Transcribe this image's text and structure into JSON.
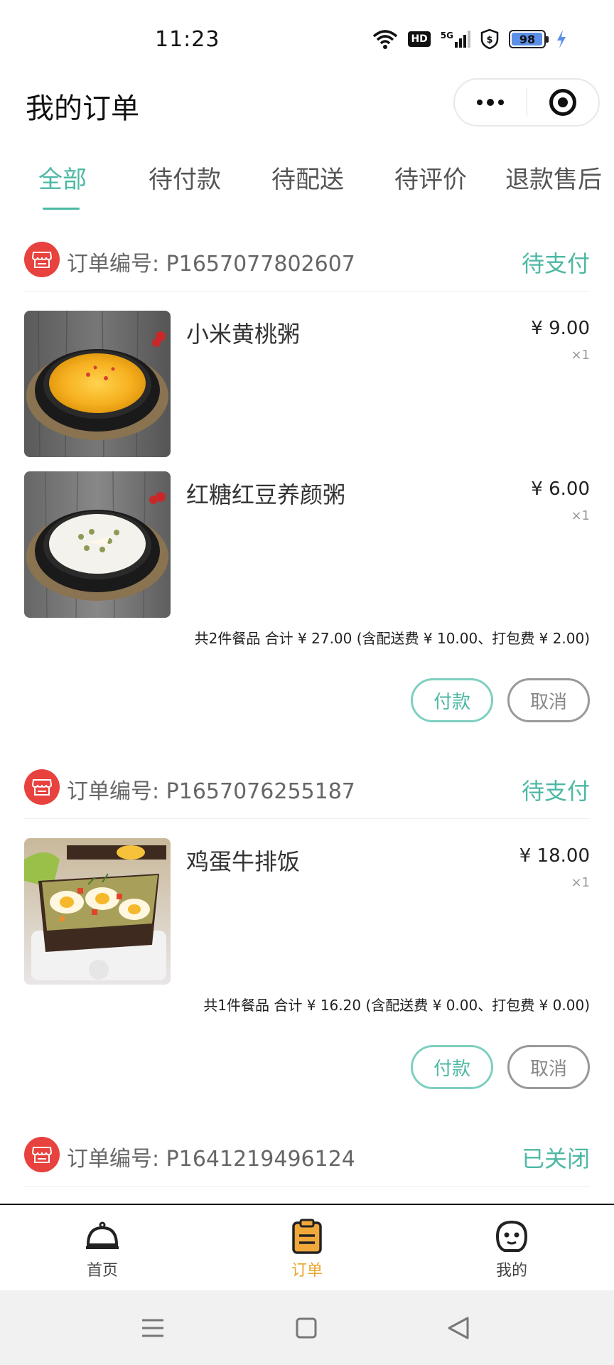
{
  "status_bar": {
    "time": "11:23",
    "network": "5G",
    "hd": "HD",
    "battery": "98",
    "battery_level": 0.98,
    "icons": [
      "wifi-icon",
      "hd-icon",
      "signal-5g-icon",
      "shield-dollar-icon",
      "battery-icon",
      "charging-icon"
    ]
  },
  "header": {
    "title": "我的订单",
    "capsule": [
      "more-dots-icon",
      "target-icon"
    ]
  },
  "tabs": [
    {
      "label": "全部",
      "active": true
    },
    {
      "label": "待付款",
      "active": false
    },
    {
      "label": "待配送",
      "active": false
    },
    {
      "label": "待评价",
      "active": false
    },
    {
      "label": "退款售后",
      "active": false
    }
  ],
  "orders": [
    {
      "order_no_label": "订单编号:",
      "order_no": "P1657077802607",
      "status": "待支付",
      "items": [
        {
          "name": "小米黄桃粥",
          "price": "¥ 9.00",
          "qty": "×1",
          "image": "yellow-porridge"
        },
        {
          "name": "红糖红豆养颜粥",
          "price": "¥ 6.00",
          "qty": "×1",
          "image": "white-porridge"
        }
      ],
      "summary": "共2件餐品 合计 ¥ 27.00 (含配送费 ¥ 10.00、打包费 ¥ 2.00)",
      "pay_label": "付款",
      "cancel_label": "取消"
    },
    {
      "order_no_label": "订单编号:",
      "order_no": "P1657076255187",
      "status": "待支付",
      "items": [
        {
          "name": "鸡蛋牛排饭",
          "price": "¥ 18.00",
          "qty": "×1",
          "image": "egg-toast"
        }
      ],
      "summary": "共1件餐品 合计 ¥ 16.20 (含配送费 ¥ 0.00、打包费 ¥ 0.00)",
      "pay_label": "付款",
      "cancel_label": "取消"
    },
    {
      "order_no_label": "订单编号:",
      "order_no": "P1641219496124",
      "status": "已关闭"
    }
  ],
  "bottom_nav": [
    {
      "label": "首页",
      "icon": "cloche-icon",
      "active": false
    },
    {
      "label": "订单",
      "icon": "clipboard-icon",
      "active": true
    },
    {
      "label": "我的",
      "icon": "face-icon",
      "active": false
    }
  ],
  "colors": {
    "accent": "#4db8a4",
    "shop_red": "#e8423f",
    "nav_active": "#e9a52c"
  }
}
